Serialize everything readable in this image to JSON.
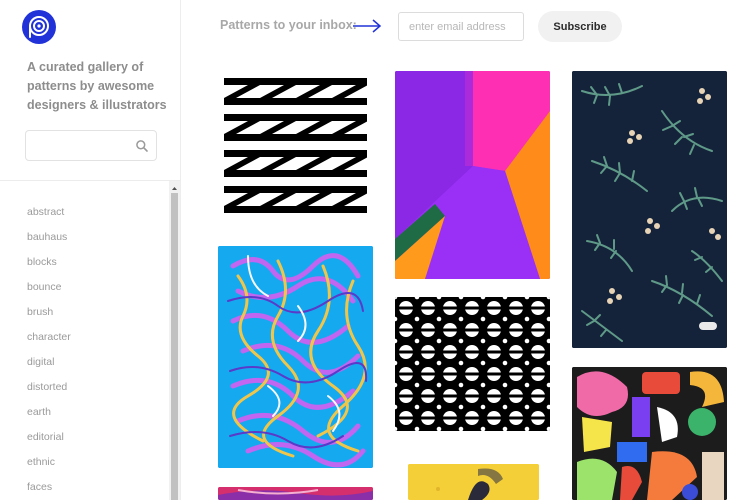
{
  "sidebar": {
    "logo": "logo-icon",
    "tagline": "A curated gallery of patterns by awesome designers & illustrators",
    "search": {
      "value": "",
      "placeholder": "",
      "icon": "search-icon"
    },
    "tags": [
      "abstract",
      "bauhaus",
      "blocks",
      "bounce",
      "brush",
      "character",
      "digital",
      "distorted",
      "earth",
      "editorial",
      "ethnic",
      "faces"
    ]
  },
  "header": {
    "subscribe_label": "Patterns to your inbox:",
    "arrow_icon": "arrow-right-icon",
    "email_placeholder": "enter email address",
    "subscribe_button": "Subscribe"
  },
  "colors": {
    "brand_blue": "#2133d8",
    "sidebar_text": "#8d8d8d"
  },
  "gallery": {
    "tiles": [
      {
        "name": "bw-zigzag-pattern"
      },
      {
        "name": "purple-geometric-pattern"
      },
      {
        "name": "navy-leaf-pattern"
      },
      {
        "name": "blue-squiggle-pattern"
      },
      {
        "name": "bw-circle-pattern"
      },
      {
        "name": "colorful-shapes-pattern"
      },
      {
        "name": "yellow-pattern-partial"
      },
      {
        "name": "pink-pattern-partial"
      }
    ]
  }
}
